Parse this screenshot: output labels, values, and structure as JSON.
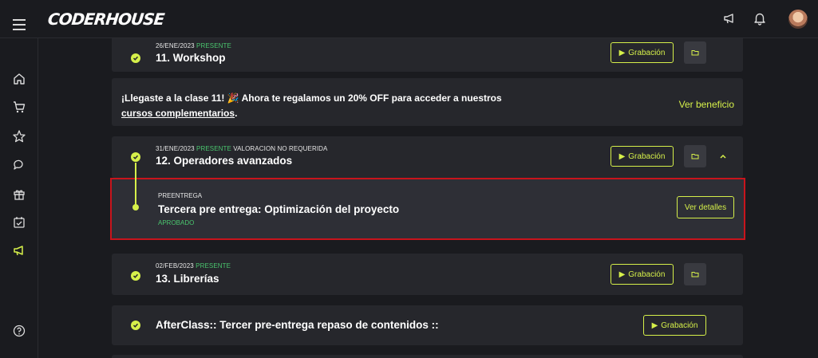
{
  "header": {
    "logo": "CODERHOUSE"
  },
  "icons": {
    "menu": "hamburger-menu-icon",
    "announcements": "megaphone-icon",
    "notifications": "bell-icon",
    "sidebar": [
      "home-icon",
      "cart-icon",
      "star-icon",
      "chat-icon",
      "gift-icon",
      "calendar-check-icon",
      "megaphone-icon"
    ],
    "help": "help-icon"
  },
  "colors": {
    "accent": "#d6f04a",
    "present": "#4ac56e",
    "highlight_border": "#c8141c",
    "card_bg": "#26272c",
    "page_bg": "#1a1b1f"
  },
  "classes": [
    {
      "date": "26/ENE/2023",
      "status": "PRESENTE",
      "extra": "",
      "title": "11. Workshop",
      "recording_label": "Grabación"
    },
    {
      "date": "31/ENE/2023",
      "status": "PRESENTE",
      "extra": "VALORACION NO REQUERIDA",
      "title": "12. Operadores avanzados",
      "recording_label": "Grabación"
    },
    {
      "date": "02/FEB/2023",
      "status": "PRESENTE",
      "extra": "",
      "title": "13. Librerías",
      "recording_label": "Grabación"
    }
  ],
  "promo": {
    "text_prefix": "¡Llegaste a la clase 11! 🎉 Ahora te regalamos un 20% OFF para acceder a nuestros",
    "link_text": "cursos complementarios",
    "text_suffix": ".",
    "cta": "Ver beneficio"
  },
  "preentrega": {
    "tag": "PREENTREGA",
    "title": "Tercera pre entrega: Optimización del proyecto",
    "status": "APROBADO",
    "details_label": "Ver detalles"
  },
  "afterclass": {
    "title": "AfterClass:: Tercer pre-entrega repaso de contenidos ::",
    "recording_label": "Grabación"
  }
}
